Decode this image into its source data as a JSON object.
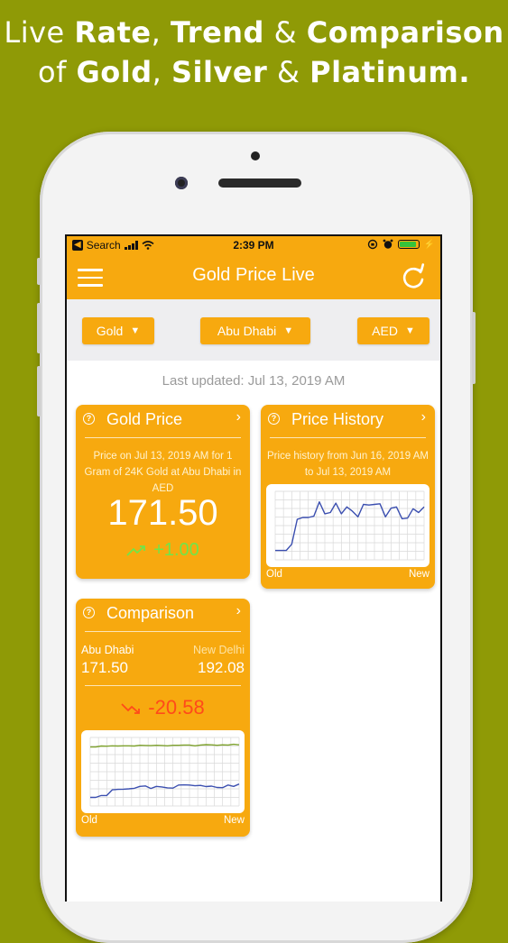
{
  "headline": {
    "line1_a": "Live ",
    "line1_b": "Rate",
    "line1_c": ", ",
    "line1_d": "Trend",
    "line1_e": " & ",
    "line1_f": "Comparison",
    "line2_a": "of ",
    "line2_b": "Gold",
    "line2_c": ", ",
    "line2_d": "Silver",
    "line2_e": " & ",
    "line2_f": "Platinum."
  },
  "status": {
    "back_label": "Search",
    "time": "2:39 PM"
  },
  "nav": {
    "title": "Gold Price Live"
  },
  "filters": {
    "metal": "Gold",
    "city": "Abu Dhabi",
    "currency": "AED"
  },
  "last_updated": "Last updated: Jul 13, 2019 AM",
  "gold_card": {
    "title": "Gold Price",
    "description": "Price on Jul 13, 2019 AM for 1 Gram of 24K Gold at Abu Dhabi in AED",
    "price": "171.50",
    "change": "+1.00"
  },
  "history_card": {
    "title": "Price History",
    "description": "Price history from Jun 16, 2019 AM to Jul 13, 2019 AM",
    "old_label": "Old",
    "new_label": "New"
  },
  "comparison_card": {
    "title": "Comparison",
    "loc1": "Abu Dhabi",
    "val1": "171.50",
    "loc2": "New Delhi",
    "val2": "192.08",
    "difference": "-20.58",
    "old_label": "Old",
    "new_label": "New"
  },
  "colors": {
    "accent": "#f7a90f",
    "background": "#8f9a06",
    "positive": "#6fe64a",
    "negative": "#ff4a1a",
    "line_blue": "#3b4fb0",
    "line_green": "#7ea22e"
  },
  "chart_data": [
    {
      "type": "line",
      "series": [
        {
          "values": [
            164.5,
            164.5,
            164.5,
            165.5,
            169.5,
            169.8,
            169.8,
            170.0,
            172.3,
            170.4,
            170.6,
            172.1,
            170.4,
            171.5,
            170.8,
            169.9,
            171.9,
            171.8,
            171.9,
            172.0,
            169.9,
            171.3,
            171.5,
            169.6,
            169.7,
            171.2,
            170.6,
            171.5
          ]
        }
      ],
      "ylim": [
        163,
        174
      ],
      "grid": true
    },
    {
      "type": "line",
      "series": [
        {
          "values": [
            191.0,
            191.0,
            191.5,
            191.4,
            191.6,
            191.5,
            191.6,
            191.6,
            191.5,
            191.9,
            191.8,
            191.7,
            191.9,
            191.8,
            191.6,
            191.9,
            191.9,
            192.0,
            192.0,
            191.6,
            192.0,
            192.2,
            192.1,
            191.9,
            192.1,
            192.0,
            192.4,
            192.1
          ]
        },
        {
          "values": [
            164.5,
            164.5,
            165.5,
            165.5,
            168.5,
            168.7,
            168.8,
            169.0,
            169.3,
            170.3,
            170.5,
            169.2,
            170.3,
            170.0,
            169.5,
            169.4,
            171.0,
            171.1,
            171.0,
            170.6,
            170.8,
            170.2,
            170.4,
            169.7,
            169.6,
            171.0,
            170.3,
            171.5
          ]
        }
      ],
      "ylim": [
        160,
        196
      ],
      "grid": true
    }
  ]
}
